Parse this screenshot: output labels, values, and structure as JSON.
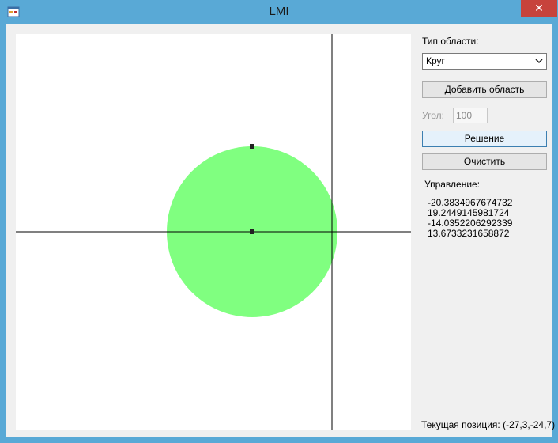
{
  "window": {
    "title": "LMI",
    "close_symbol": "✕"
  },
  "panel": {
    "region_type_label": "Тип области:",
    "region_type_selected": "Круг",
    "add_region_button": "Добавить область",
    "angle_label": "Угол:",
    "angle_value": "100",
    "solve_button": "Решение",
    "clear_button": "Очистить",
    "control_label": "Управление:",
    "control_values": [
      "-20.3834967674732",
      "19.2449145981724",
      "-14.0352206292339",
      "13.6733231658872"
    ],
    "current_position": "Текущая позиция: (-27,3,-24,7)"
  },
  "colors": {
    "circle_fill": "#80ff80",
    "axis": "#000000",
    "handle": "#222222",
    "close_button": "#c7433c"
  }
}
